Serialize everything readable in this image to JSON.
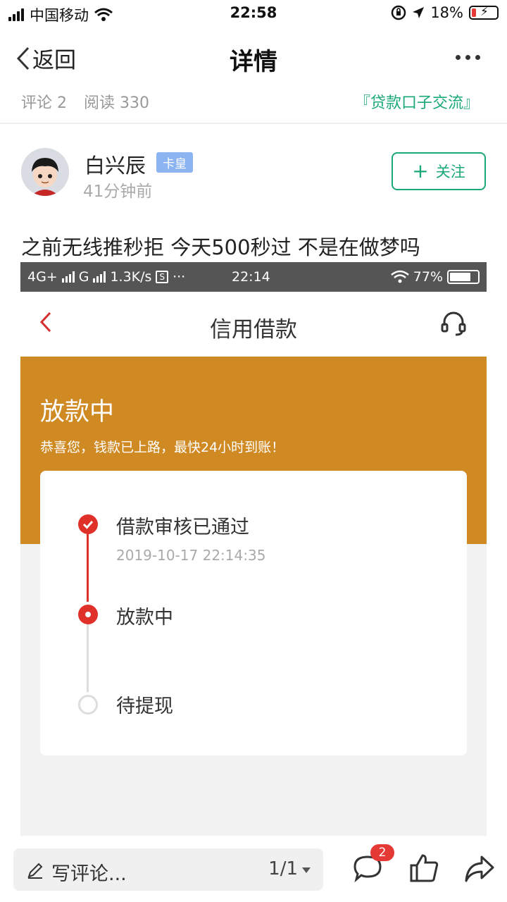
{
  "status_bar": {
    "carrier": "中国移动",
    "time": "22:58",
    "battery": "18%",
    "battery_level": 0.18
  },
  "nav": {
    "back_label": "返回",
    "title": "详情"
  },
  "meta": {
    "comments": "评论 2",
    "reads": "阅读 330",
    "topic": "『贷款口子交流』"
  },
  "author": {
    "name": "白兴辰",
    "badge": "卡皇",
    "time_ago": "41分钟前",
    "follow_label": "关注"
  },
  "post": {
    "text": "之前无线推秒拒 今天500秒过 不是在做梦吗"
  },
  "embedded": {
    "status": {
      "network": "4G+",
      "network2": "G",
      "speed": "1.3K/s",
      "more": "···",
      "time": "22:14",
      "battery": "77%",
      "battery_level": 0.77
    },
    "title": "信用借款",
    "status_title": "放款中",
    "status_sub": "恭喜您，钱款已上路，最快24小时到账！",
    "steps": [
      {
        "label": "借款审核已通过",
        "time": "2019-10-17 22:14:35",
        "state": "done"
      },
      {
        "label": "放款中",
        "state": "current"
      },
      {
        "label": "待提现",
        "state": "pending"
      }
    ],
    "accent": "#e0302a",
    "banner_color": "#d08a24"
  },
  "bottom": {
    "comment_placeholder": "写评论...",
    "page": "1/1",
    "comment_badge": "2"
  },
  "colors": {
    "green": "#1aa77a",
    "badge_blue": "#8cb4f0"
  }
}
